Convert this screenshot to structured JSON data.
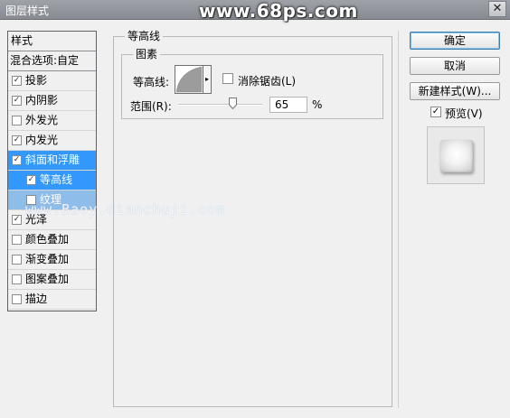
{
  "window": {
    "title": "图层样式",
    "watermark": "www.68ps.com",
    "close": "✕"
  },
  "left_panel": {
    "header": "样式",
    "blend": "混合选项:自定",
    "items": [
      {
        "label": "投影",
        "checked": true
      },
      {
        "label": "内阴影",
        "checked": true
      },
      {
        "label": "外发光",
        "checked": false
      },
      {
        "label": "内发光",
        "checked": true
      },
      {
        "label": "斜面和浮雕",
        "checked": true,
        "selected": true
      },
      {
        "label": "等高线",
        "checked": true,
        "sub": true,
        "active": true
      },
      {
        "label": "纹理",
        "checked": false,
        "sub": true
      },
      {
        "label": "光泽",
        "checked": true
      },
      {
        "label": "颜色叠加",
        "checked": false
      },
      {
        "label": "渐变叠加",
        "checked": false
      },
      {
        "label": "图案叠加",
        "checked": false
      },
      {
        "label": "描边",
        "checked": false
      }
    ],
    "site_watermark": "www.Baoy.dianchuji.com"
  },
  "main": {
    "group_title": "等高线",
    "sub_group_title": "图素",
    "contour_label": "等高线:",
    "antialias_label": "消除锯齿(L)",
    "antialias_checked": false,
    "range_label": "范围(R):",
    "range_value": "65",
    "range_unit": "%",
    "range_fraction": 0.65
  },
  "buttons": {
    "ok": "确定",
    "cancel": "取消",
    "new_style": "新建样式(W)...",
    "preview_label": "预览(V)",
    "preview_checked": true
  },
  "colors": {
    "selection": "#3298fd",
    "sub_selection": "#8fbde9"
  },
  "icons": {
    "checkbox_mark": "✓",
    "dropdown_arrow": "▸"
  }
}
